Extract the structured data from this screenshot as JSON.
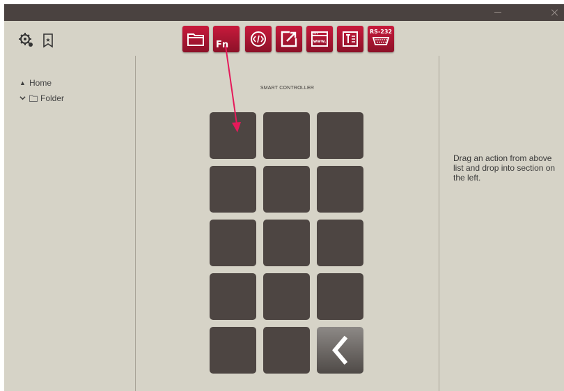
{
  "window": {
    "minimize_label": "Minimize",
    "close_label": "Close"
  },
  "toolbar": {
    "left_icons": [
      "settings-icon",
      "bookmark-icon"
    ],
    "actions": [
      {
        "name": "folder-icon",
        "label": ""
      },
      {
        "name": "function-icon",
        "label": "Fn"
      },
      {
        "name": "code-icon",
        "label": ""
      },
      {
        "name": "external-link-icon",
        "label": ""
      },
      {
        "name": "web-page-icon",
        "label": "www."
      },
      {
        "name": "text-document-icon",
        "label": ""
      },
      {
        "name": "serial-port-icon",
        "label": "RS-232"
      }
    ],
    "accent_color": "#b5173a"
  },
  "tree": {
    "items": [
      {
        "label": "Home",
        "caret": "▲"
      },
      {
        "label": "Folder",
        "caret": "⌄"
      }
    ]
  },
  "controller": {
    "title": "SMART CONTROLLER",
    "slots_count": 15,
    "back_icon": "chevron-left-icon"
  },
  "hint": {
    "text": "Drag an action from above list and drop into section on the left."
  },
  "colors": {
    "window_bg": "#d6d3c7",
    "titlebar_bg": "#4a4240",
    "slot_bg": "#4d4542",
    "arrow": "#e5195a"
  }
}
